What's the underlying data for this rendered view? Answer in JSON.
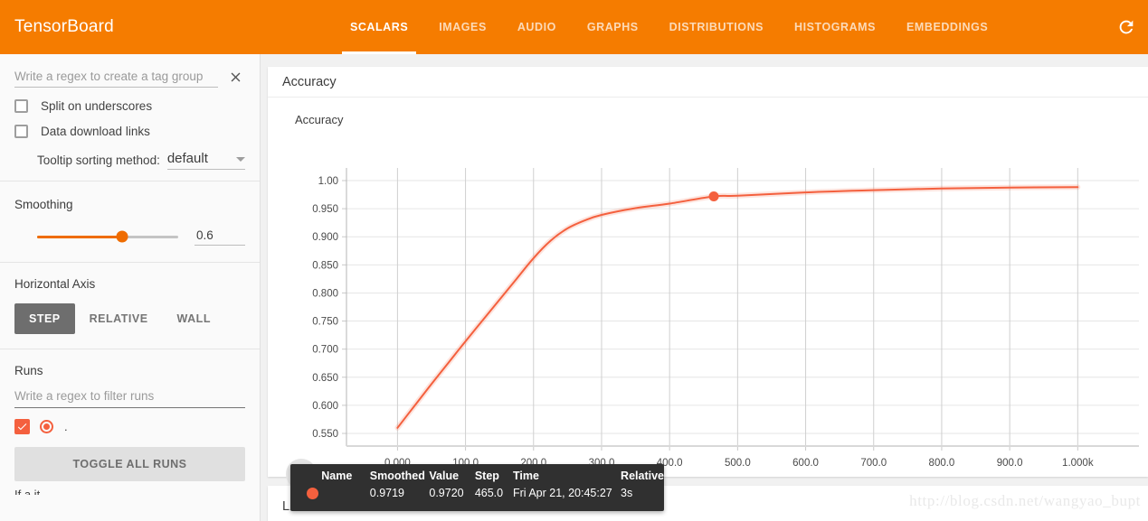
{
  "header": {
    "brand": "TensorBoard",
    "reload_icon": "refresh-icon",
    "tabs": [
      {
        "label": "SCALARS",
        "active": true
      },
      {
        "label": "IMAGES",
        "active": false
      },
      {
        "label": "AUDIO",
        "active": false
      },
      {
        "label": "GRAPHS",
        "active": false
      },
      {
        "label": "DISTRIBUTIONS",
        "active": false
      },
      {
        "label": "HISTOGRAMS",
        "active": false
      },
      {
        "label": "EMBEDDINGS",
        "active": false
      }
    ]
  },
  "sidebar": {
    "tag_regex_placeholder": "Write a regex to create a tag group",
    "tag_regex_value": "",
    "close_icon": "close-icon",
    "split_on_underscores": {
      "label": "Split on underscores",
      "checked": false
    },
    "data_download_links": {
      "label": "Data download links",
      "checked": false
    },
    "tooltip_sorting": {
      "label": "Tooltip sorting method:",
      "value": "default"
    },
    "smoothing": {
      "title": "Smoothing",
      "value": "0.6",
      "fraction": 0.6
    },
    "horizontal_axis": {
      "title": "Horizontal Axis",
      "options": [
        {
          "label": "STEP",
          "selected": true
        },
        {
          "label": "RELATIVE",
          "selected": false
        },
        {
          "label": "WALL",
          "selected": false
        }
      ]
    },
    "runs": {
      "title": "Runs",
      "filter_placeholder": "Write a regex to filter runs",
      "filter_value": "",
      "items": [
        {
          "name": ".",
          "checked": true,
          "color": "#f4603e"
        }
      ],
      "toggle_all_label": "TOGGLE ALL RUNS",
      "clipped_label": "If a it"
    }
  },
  "main": {
    "cards": [
      {
        "title": "Accuracy"
      },
      {
        "title": "L2Loss"
      }
    ],
    "tools": [
      {
        "name": "fit-domain-icon",
        "hover": true
      },
      {
        "name": "data-series-icon",
        "hover": false
      }
    ]
  },
  "tooltip": {
    "columns": [
      "Name",
      "Smoothed",
      "Value",
      "Step",
      "Time",
      "Relative"
    ],
    "rows": [
      {
        "swatch_color": "#f4603e",
        "name": "",
        "smoothed": "0.9719",
        "value": "0.9720",
        "step": "465.0",
        "time": "Fri Apr 21, 20:45:27",
        "relative": "3s"
      }
    ]
  },
  "watermark": "http://blog.csdn.net/wangyao_bupt",
  "chart_data": {
    "type": "line",
    "title": "Accuracy",
    "xlabel": "",
    "ylabel": "",
    "xlim": [
      -75,
      1090
    ],
    "ylim": [
      0.5275,
      1.0225
    ],
    "grid": true,
    "line_color": "#f4603e",
    "x_ticks": [
      "0.000",
      "100.0",
      "200.0",
      "300.0",
      "400.0",
      "500.0",
      "600.0",
      "700.0",
      "800.0",
      "900.0",
      "1.000k"
    ],
    "x_tick_values": [
      0,
      100,
      200,
      300,
      400,
      500,
      600,
      700,
      800,
      900,
      1000
    ],
    "y_ticks": [
      "1.00",
      "0.950",
      "0.900",
      "0.850",
      "0.800",
      "0.750",
      "0.700",
      "0.650",
      "0.600",
      "0.550"
    ],
    "y_tick_values": [
      1.0,
      0.95,
      0.9,
      0.85,
      0.8,
      0.75,
      0.7,
      0.65,
      0.6,
      0.55
    ],
    "series": [
      {
        "name": ".",
        "color": "#f4603e",
        "x": [
          0,
          25,
          50,
          75,
          100,
          125,
          150,
          175,
          200,
          225,
          250,
          275,
          300,
          350,
          400,
          465,
          500,
          600,
          700,
          800,
          900,
          1000
        ],
        "y": [
          0.56,
          0.599,
          0.638,
          0.676,
          0.714,
          0.751,
          0.788,
          0.825,
          0.862,
          0.893,
          0.915,
          0.929,
          0.939,
          0.951,
          0.959,
          0.9719,
          0.973,
          0.979,
          0.983,
          0.986,
          0.9875,
          0.9885
        ]
      }
    ],
    "highlight_point": {
      "step": 465.0,
      "value": 0.972,
      "smoothed": 0.9719
    }
  }
}
